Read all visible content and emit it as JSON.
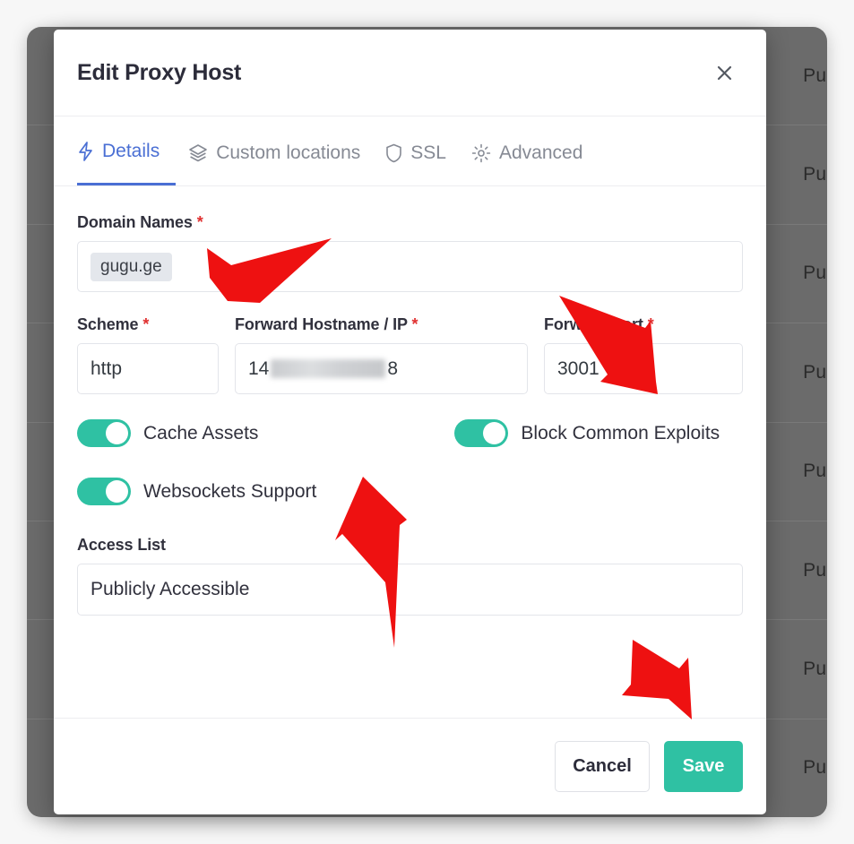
{
  "background": {
    "row_label": "Publ",
    "row_count": 8,
    "dim_color": "#6b6b6b"
  },
  "modal": {
    "title": "Edit Proxy Host",
    "close_icon": "close-icon",
    "tabs": [
      {
        "label": "Details",
        "icon": "lightning-icon",
        "active": true
      },
      {
        "label": "Custom locations",
        "icon": "layers-icon",
        "active": false
      },
      {
        "label": "SSL",
        "icon": "shield-icon",
        "active": false
      },
      {
        "label": "Advanced",
        "icon": "gear-icon",
        "active": false
      }
    ],
    "fields": {
      "domain_names": {
        "label": "Domain Names",
        "required_marker": "*",
        "tags": [
          "gugu.ge"
        ]
      },
      "scheme": {
        "label": "Scheme",
        "required_marker": "*",
        "value": "http"
      },
      "forward_hostname": {
        "label": "Forward Hostname / IP",
        "required_marker": "*",
        "value_prefix": "14",
        "value_suffix": "8",
        "redacted": true
      },
      "forward_port": {
        "label": "Forward Port",
        "required_marker": "*",
        "value": "3001"
      },
      "access_list": {
        "label": "Access List",
        "value": "Publicly Accessible"
      }
    },
    "toggles": [
      {
        "label": "Cache Assets",
        "on": true
      },
      {
        "label": "Block Common Exploits",
        "on": true
      },
      {
        "label": "Websockets Support",
        "on": true
      }
    ],
    "footer": {
      "cancel_label": "Cancel",
      "save_label": "Save"
    }
  },
  "colors": {
    "accent_blue": "#4a6fd4",
    "toggle_teal": "#2fc1a3",
    "save_teal": "#2fc1a3",
    "required_red": "#e03030",
    "annotation_red": "#ee1111"
  },
  "annotations": {
    "arrows": [
      {
        "name": "arrow-to-domain-names",
        "direction": "left"
      },
      {
        "name": "arrow-to-forward-port",
        "direction": "down-right"
      },
      {
        "name": "arrow-to-toggles",
        "direction": "up"
      },
      {
        "name": "arrow-to-save",
        "direction": "down-right"
      }
    ]
  }
}
